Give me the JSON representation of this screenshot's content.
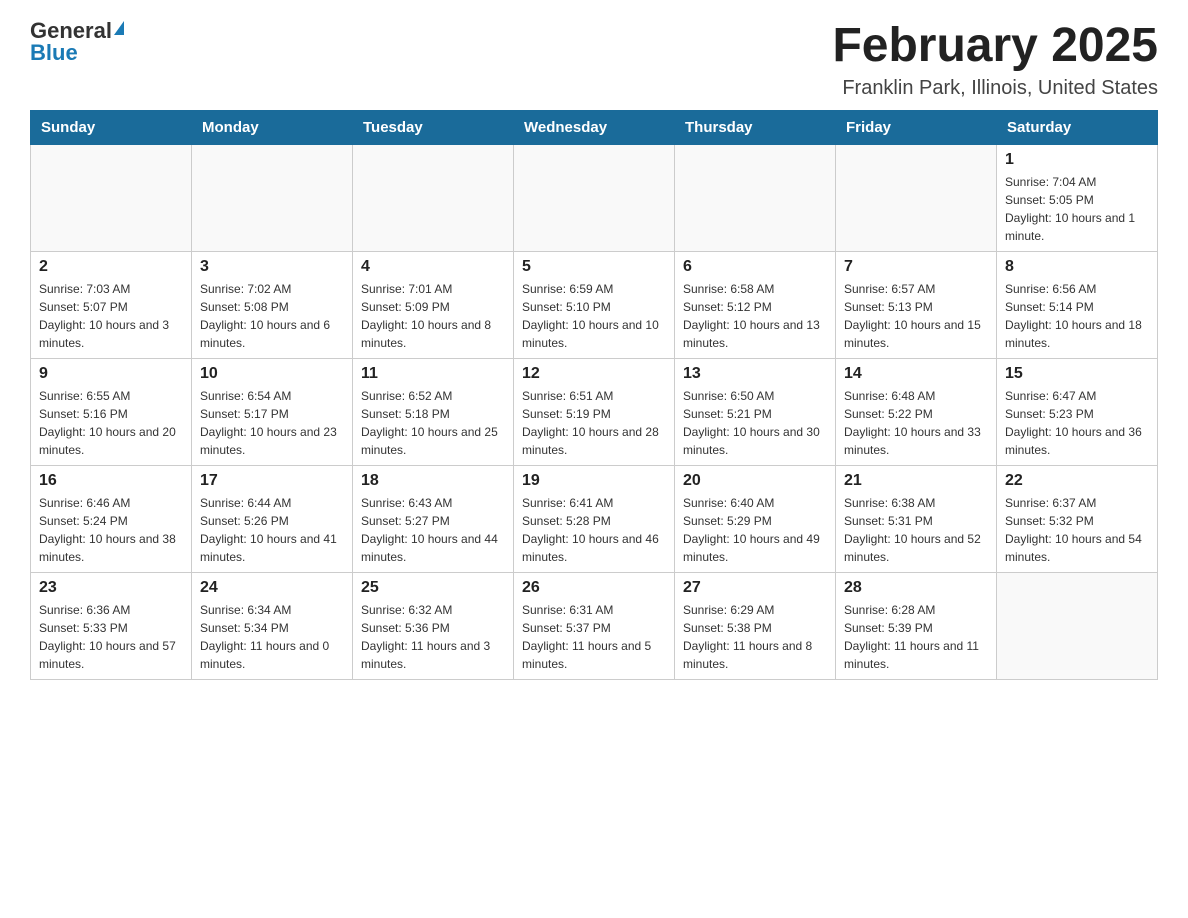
{
  "header": {
    "logo_general": "General",
    "logo_blue": "Blue",
    "title": "February 2025",
    "subtitle": "Franklin Park, Illinois, United States"
  },
  "weekdays": [
    "Sunday",
    "Monday",
    "Tuesday",
    "Wednesday",
    "Thursday",
    "Friday",
    "Saturday"
  ],
  "weeks": [
    [
      {
        "day": "",
        "info": ""
      },
      {
        "day": "",
        "info": ""
      },
      {
        "day": "",
        "info": ""
      },
      {
        "day": "",
        "info": ""
      },
      {
        "day": "",
        "info": ""
      },
      {
        "day": "",
        "info": ""
      },
      {
        "day": "1",
        "info": "Sunrise: 7:04 AM\nSunset: 5:05 PM\nDaylight: 10 hours and 1 minute."
      }
    ],
    [
      {
        "day": "2",
        "info": "Sunrise: 7:03 AM\nSunset: 5:07 PM\nDaylight: 10 hours and 3 minutes."
      },
      {
        "day": "3",
        "info": "Sunrise: 7:02 AM\nSunset: 5:08 PM\nDaylight: 10 hours and 6 minutes."
      },
      {
        "day": "4",
        "info": "Sunrise: 7:01 AM\nSunset: 5:09 PM\nDaylight: 10 hours and 8 minutes."
      },
      {
        "day": "5",
        "info": "Sunrise: 6:59 AM\nSunset: 5:10 PM\nDaylight: 10 hours and 10 minutes."
      },
      {
        "day": "6",
        "info": "Sunrise: 6:58 AM\nSunset: 5:12 PM\nDaylight: 10 hours and 13 minutes."
      },
      {
        "day": "7",
        "info": "Sunrise: 6:57 AM\nSunset: 5:13 PM\nDaylight: 10 hours and 15 minutes."
      },
      {
        "day": "8",
        "info": "Sunrise: 6:56 AM\nSunset: 5:14 PM\nDaylight: 10 hours and 18 minutes."
      }
    ],
    [
      {
        "day": "9",
        "info": "Sunrise: 6:55 AM\nSunset: 5:16 PM\nDaylight: 10 hours and 20 minutes."
      },
      {
        "day": "10",
        "info": "Sunrise: 6:54 AM\nSunset: 5:17 PM\nDaylight: 10 hours and 23 minutes."
      },
      {
        "day": "11",
        "info": "Sunrise: 6:52 AM\nSunset: 5:18 PM\nDaylight: 10 hours and 25 minutes."
      },
      {
        "day": "12",
        "info": "Sunrise: 6:51 AM\nSunset: 5:19 PM\nDaylight: 10 hours and 28 minutes."
      },
      {
        "day": "13",
        "info": "Sunrise: 6:50 AM\nSunset: 5:21 PM\nDaylight: 10 hours and 30 minutes."
      },
      {
        "day": "14",
        "info": "Sunrise: 6:48 AM\nSunset: 5:22 PM\nDaylight: 10 hours and 33 minutes."
      },
      {
        "day": "15",
        "info": "Sunrise: 6:47 AM\nSunset: 5:23 PM\nDaylight: 10 hours and 36 minutes."
      }
    ],
    [
      {
        "day": "16",
        "info": "Sunrise: 6:46 AM\nSunset: 5:24 PM\nDaylight: 10 hours and 38 minutes."
      },
      {
        "day": "17",
        "info": "Sunrise: 6:44 AM\nSunset: 5:26 PM\nDaylight: 10 hours and 41 minutes."
      },
      {
        "day": "18",
        "info": "Sunrise: 6:43 AM\nSunset: 5:27 PM\nDaylight: 10 hours and 44 minutes."
      },
      {
        "day": "19",
        "info": "Sunrise: 6:41 AM\nSunset: 5:28 PM\nDaylight: 10 hours and 46 minutes."
      },
      {
        "day": "20",
        "info": "Sunrise: 6:40 AM\nSunset: 5:29 PM\nDaylight: 10 hours and 49 minutes."
      },
      {
        "day": "21",
        "info": "Sunrise: 6:38 AM\nSunset: 5:31 PM\nDaylight: 10 hours and 52 minutes."
      },
      {
        "day": "22",
        "info": "Sunrise: 6:37 AM\nSunset: 5:32 PM\nDaylight: 10 hours and 54 minutes."
      }
    ],
    [
      {
        "day": "23",
        "info": "Sunrise: 6:36 AM\nSunset: 5:33 PM\nDaylight: 10 hours and 57 minutes."
      },
      {
        "day": "24",
        "info": "Sunrise: 6:34 AM\nSunset: 5:34 PM\nDaylight: 11 hours and 0 minutes."
      },
      {
        "day": "25",
        "info": "Sunrise: 6:32 AM\nSunset: 5:36 PM\nDaylight: 11 hours and 3 minutes."
      },
      {
        "day": "26",
        "info": "Sunrise: 6:31 AM\nSunset: 5:37 PM\nDaylight: 11 hours and 5 minutes."
      },
      {
        "day": "27",
        "info": "Sunrise: 6:29 AM\nSunset: 5:38 PM\nDaylight: 11 hours and 8 minutes."
      },
      {
        "day": "28",
        "info": "Sunrise: 6:28 AM\nSunset: 5:39 PM\nDaylight: 11 hours and 11 minutes."
      },
      {
        "day": "",
        "info": ""
      }
    ]
  ]
}
